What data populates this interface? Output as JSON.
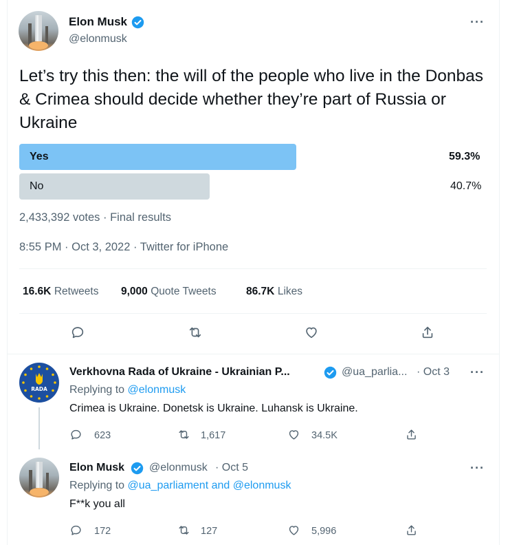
{
  "main_tweet": {
    "author_name": "Elon Musk",
    "author_handle": "@elonmusk",
    "text": "Let’s try this then: the will of the people who live in the Donbas & Crimea should decide whether they’re part of Russia or Ukraine",
    "poll": {
      "options": [
        {
          "label": "Yes",
          "percent_text": "59.3%",
          "percent": 59.3,
          "winner": true
        },
        {
          "label": "No",
          "percent_text": "40.7%",
          "percent": 40.7,
          "winner": false
        }
      ],
      "summary": "2,433,392 votes · Final results"
    },
    "timestamp": "8:55 PM · Oct 3, 2022 · Twitter for iPhone",
    "stats": {
      "retweets_count": "16.6K",
      "retweets_label": "Retweets",
      "quotes_count": "9,000",
      "quotes_label": "Quote Tweets",
      "likes_count": "86.7K",
      "likes_label": "Likes"
    }
  },
  "replies": [
    {
      "author_name": "Verkhovna Rada of Ukraine - Ukrainian P...",
      "author_handle": "@ua_parlia...",
      "date": "· Oct 3",
      "replying_prefix": "Replying to",
      "replying_to": "@elonmusk",
      "text": "Crimea is Ukraine. Donetsk is Ukraine. Luhansk is Ukraine.",
      "counts": {
        "replies": "623",
        "retweets": "1,617",
        "likes": "34.5K"
      },
      "avatar_text": "RADA"
    },
    {
      "author_name": "Elon Musk",
      "author_handle": "@elonmusk",
      "date": "· Oct 5",
      "replying_prefix": "Replying to",
      "replying_to": "@ua_parliament and @elonmusk",
      "text": "F**k you all",
      "counts": {
        "replies": "172",
        "retweets": "127",
        "likes": "5,996"
      }
    }
  ],
  "colors": {
    "accent": "#1d9bf0",
    "poll_winner": "#7cc3f5",
    "poll_other": "#cfd9de",
    "secondary_text": "#536471"
  },
  "icons": {
    "verified": "verified-badge-icon",
    "more": "more-dots-icon",
    "reply": "reply-bubble-icon",
    "retweet": "retweet-arrows-icon",
    "like": "heart-icon",
    "share": "share-upload-icon"
  },
  "more_glyph": "···"
}
